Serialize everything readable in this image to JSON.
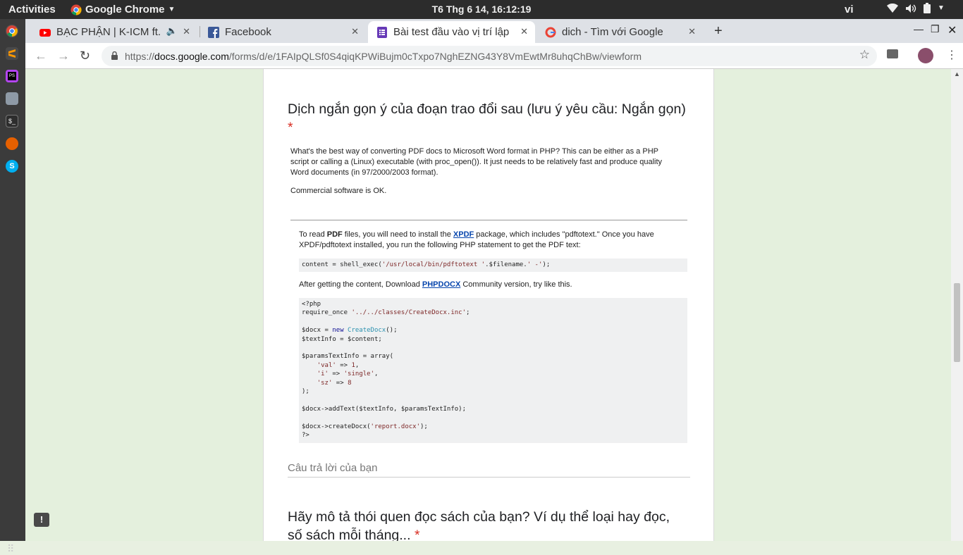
{
  "system": {
    "activities": "Activities",
    "app_name": "Google Chrome",
    "clock": "T6 Thg 6 14, 16:12:19",
    "lang": "vi"
  },
  "tabs": [
    {
      "title": "BẠC PHẬN | K-ICM ft. J",
      "favicon": "youtube-icon",
      "color": "#ff0000"
    },
    {
      "title": "Facebook",
      "favicon": "facebook-icon",
      "color": "#3b5998"
    },
    {
      "title": "Bài test đầu vào vị trí lập",
      "favicon": "forms-icon",
      "color": "#673ab7"
    },
    {
      "title": "dich - Tìm với Google",
      "favicon": "google-icon",
      "color": "#4285f4"
    }
  ],
  "url": {
    "scheme": "https://",
    "host": "docs.google.com",
    "path": "/forms/d/e/1FAIpQLSf0S4qiqKPWiBujm0cTxpo7NghEZNG43Y8VmEwtMr8uhqChBw/viewform"
  },
  "form": {
    "q1_title": "Dịch ngắn gọn ý của đoạn trao đổi sau (lưu ý yêu cầu: Ngắn gọn)",
    "required_mark": "*",
    "answer_placeholder": "Câu trả lời của bạn",
    "q2_line1": "Hãy mô tả thói quen đọc sách của bạn? Ví dụ thể loại hay đọc,",
    "q2_line2": "số sách mỗi tháng..."
  },
  "image": {
    "question_p1": "What's the best way of converting PDF docs to Microsoft Word format in PHP? This can be either as a PHP",
    "question_p2": "script or calling a (Linux) executable (with proc_open()). It just needs to be relatively fast and produce quality",
    "question_p3": "Word documents (in 97/2000/2003 format).",
    "question_p4": "Commercial software is OK.",
    "answer_a": "To read ",
    "answer_b": "PDF",
    "answer_c": " files, you will need to install the ",
    "answer_link1": "XPDF",
    "answer_d": " package, which includes \"pdftotext.\" Once you have",
    "answer_e": "XPDF/pdftotext installed, you run the following PHP statement to get the PDF text:",
    "code1_a": "content = shell_exec(",
    "code1_b": "'/usr/local/bin/pdftotext '",
    "code1_c": ".$filename.",
    "code1_d": "' -'",
    "code1_e": ");",
    "after_a": "After getting the content, Download ",
    "after_link": "PHPDOCX",
    "after_b": " Community version, try like this.",
    "code2": {
      "l1": "<?php",
      "l2a": "require_once ",
      "l2b": "'../../classes/CreateDocx.inc'",
      "l2c": ";",
      "l3a": "$docx = ",
      "l3b": "new",
      "l3c": " CreateDocx",
      "l3d": "();",
      "l4": "$textInfo = $content;",
      "l5": "$paramsTextInfo = array(",
      "l6a": "    ",
      "l6b": "'val'",
      "l6c": " => ",
      "l6d": "1",
      "l6e": ",",
      "l7a": "    ",
      "l7b": "'i'",
      "l7c": " => ",
      "l7d": "'single'",
      "l7e": ",",
      "l8a": "    ",
      "l8b": "'sz'",
      "l8c": " => ",
      "l8d": "8",
      "l9": ");",
      "l10": "$docx->addText($textInfo, $paramsTextInfo);",
      "l11a": "$docx->createDocx(",
      "l11b": "'report.docx'",
      "l11c": ");",
      "l12": "?>"
    }
  }
}
